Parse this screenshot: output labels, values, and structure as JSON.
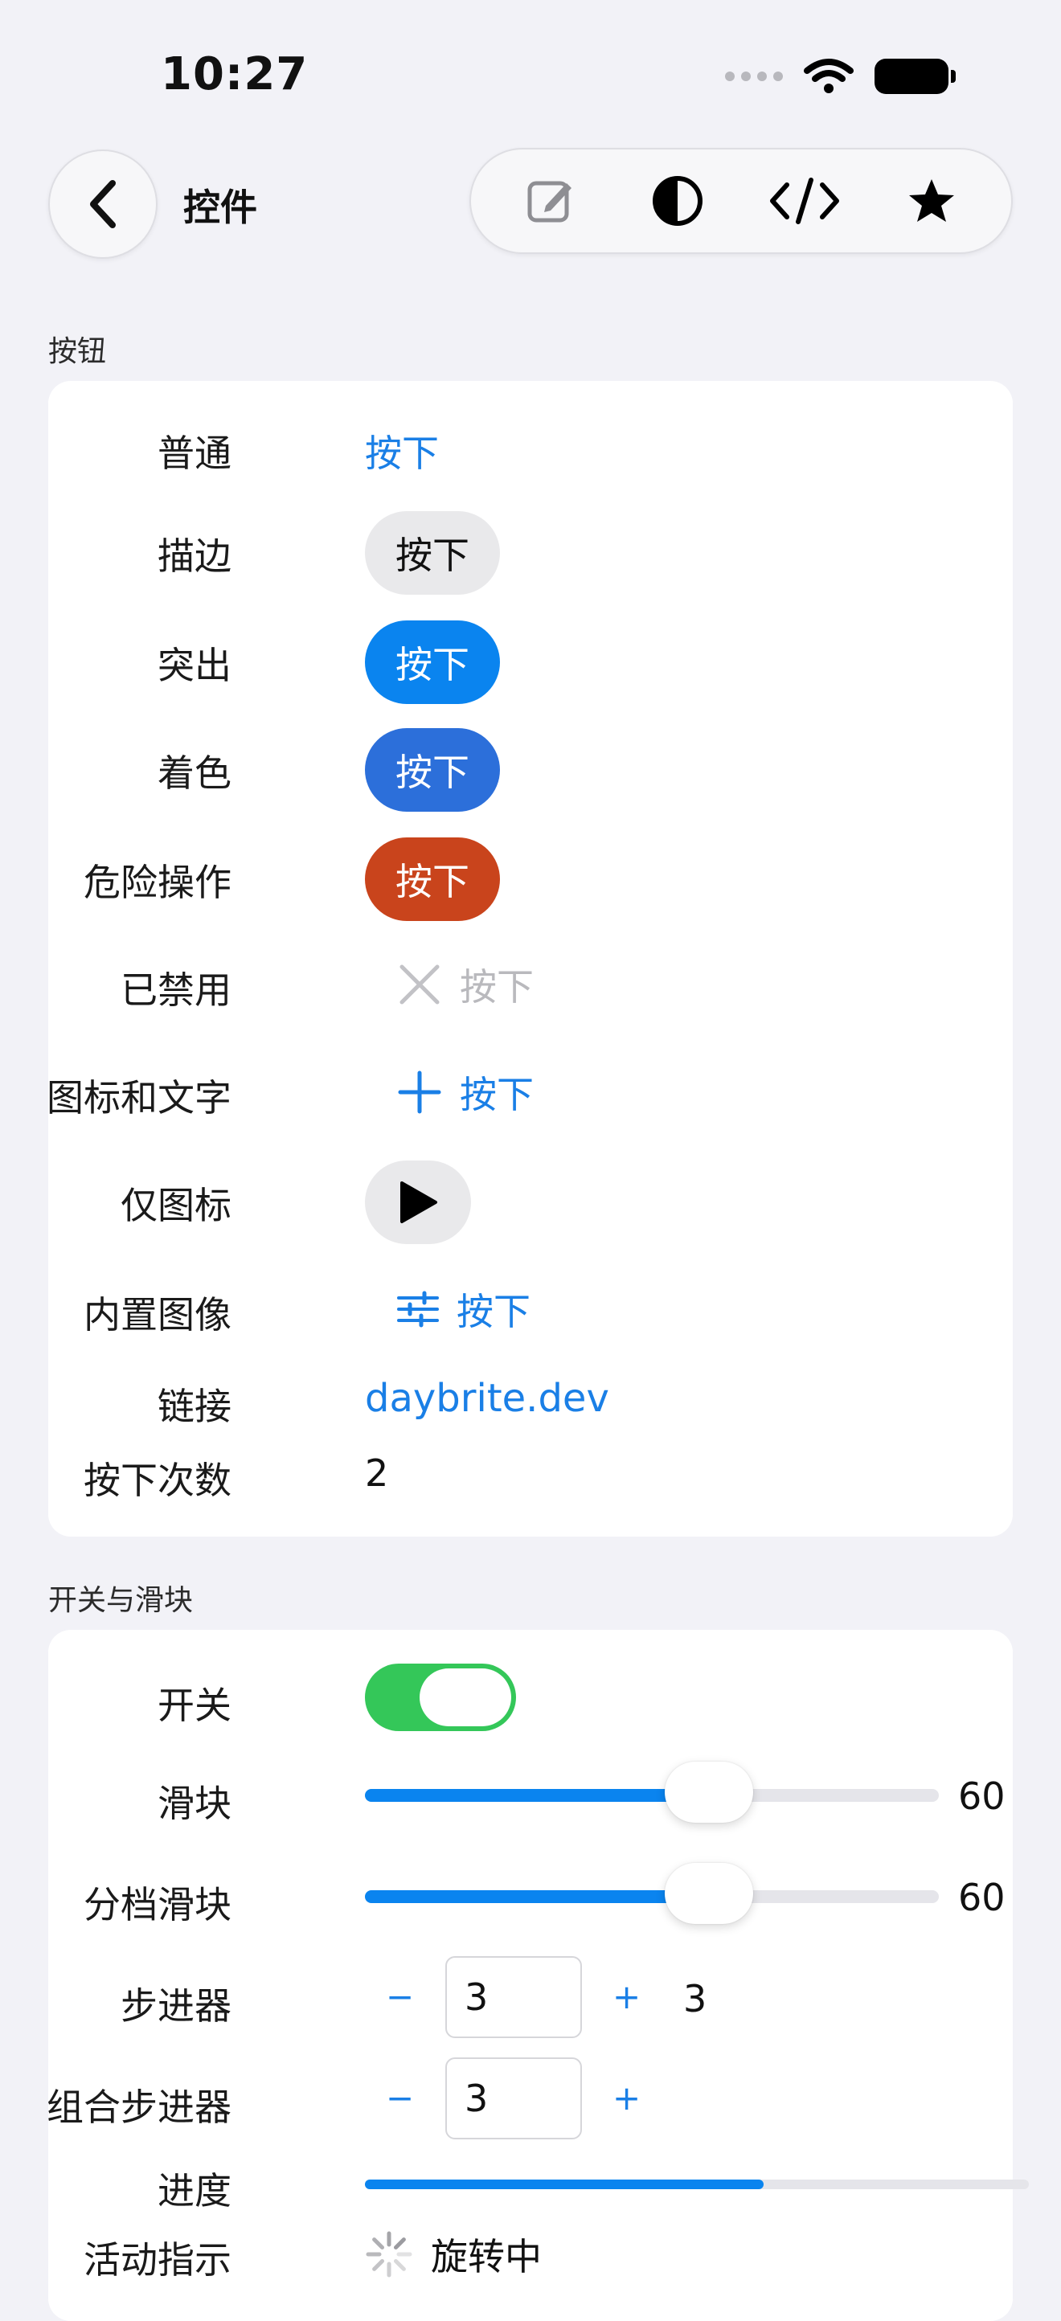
{
  "status_bar": {
    "time": "10:27"
  },
  "nav": {
    "title": "控件",
    "toolbar_icons": [
      "compose-icon",
      "contrast-icon",
      "code-icon",
      "star-icon"
    ]
  },
  "sections": {
    "buttons_header": "按钮",
    "switches_header": "开关与滑块"
  },
  "buttons": {
    "plain_label": "普通",
    "plain_button": "按下",
    "bordered_label": "描边",
    "bordered_button": "按下",
    "prominent_label": "突出",
    "prominent_button": "按下",
    "tinted_label": "着色",
    "tinted_button": "按下",
    "destructive_label": "危险操作",
    "destructive_button": "按下",
    "disabled_label": "已禁用",
    "disabled_button": "按下",
    "icon_text_label": "图标和文字",
    "icon_text_button": "按下",
    "icon_only_label": "仅图标",
    "builtin_image_label": "内置图像",
    "builtin_image_button": "按下",
    "link_label": "链接",
    "link_text": "daybrite.dev",
    "press_count_label": "按下次数",
    "press_count_value": "2"
  },
  "controls": {
    "switch_label": "开关",
    "switch_on": true,
    "slider_label": "滑块",
    "slider_value": "60",
    "slider_fraction": 0.6,
    "stepped_slider_label": "分档滑块",
    "stepped_slider_value": "60",
    "stepped_slider_fraction": 0.6,
    "stepper_label": "步进器",
    "stepper_minus": "−",
    "stepper_field_value": "3",
    "stepper_plus": "+",
    "stepper_value": "3",
    "combo_stepper_label": "组合步进器",
    "combo_stepper_minus": "−",
    "combo_stepper_field_value": "3",
    "combo_stepper_plus": "+",
    "progress_label": "进度",
    "progress_fraction": 0.6,
    "activity_label": "活动指示",
    "activity_text": "旋转中"
  },
  "colors": {
    "accent": "#0a84ef",
    "switch_on": "#34c759",
    "destructive": "#c9441c",
    "tinted": "#2c6fda"
  }
}
